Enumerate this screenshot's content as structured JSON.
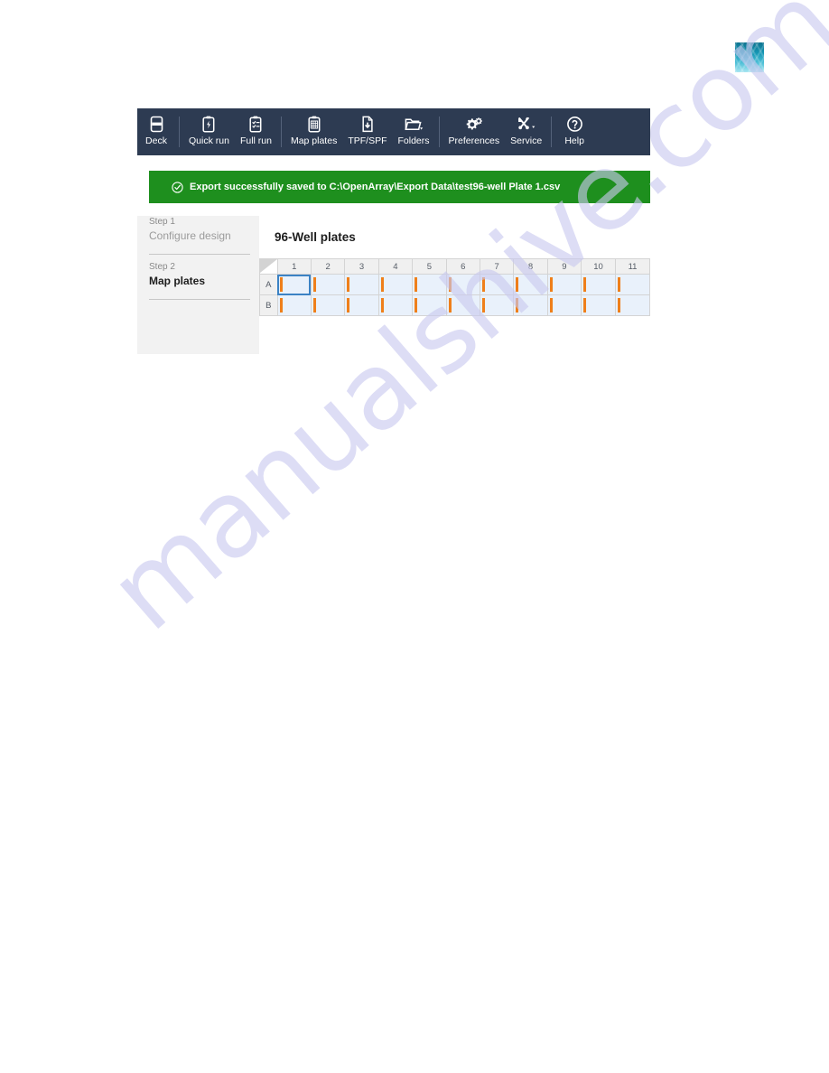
{
  "brand": {
    "logo_name": "applied-biosystems-logo",
    "accent_top": "#0e7490",
    "accent_bottom": "#a9e6f2"
  },
  "watermark": {
    "text": "manualshive.com",
    "color": "#c9c9ef"
  },
  "toolbar": {
    "background": "#2d3b52",
    "groups": [
      {
        "items": [
          {
            "label": "Deck",
            "icon": "deck-icon"
          }
        ]
      },
      {
        "items": [
          {
            "label": "Quick run",
            "icon": "clipboard-bolt-icon"
          },
          {
            "label": "Full run",
            "icon": "clipboard-list-icon"
          }
        ]
      },
      {
        "items": [
          {
            "label": "Map plates",
            "icon": "clipboard-grid-icon"
          },
          {
            "label": "TPF/SPF",
            "icon": "file-download-icon"
          },
          {
            "label": "Folders",
            "icon": "folder-dropdown-icon"
          }
        ]
      },
      {
        "items": [
          {
            "label": "Preferences",
            "icon": "gears-icon"
          },
          {
            "label": "Service",
            "icon": "tools-dropdown-icon"
          }
        ]
      },
      {
        "items": [
          {
            "label": "Help",
            "icon": "question-circle-icon"
          }
        ]
      }
    ]
  },
  "banner": {
    "icon": "check-circle-icon",
    "message": "Export successfully saved to C:\\OpenArray\\Export Data\\test96-well Plate 1.csv",
    "color": "#1e8f1e"
  },
  "sidebar": {
    "steps": [
      {
        "num": "Step 1",
        "name": "Configure design",
        "active": false
      },
      {
        "num": "Step 2",
        "name": "Map plates",
        "active": true
      }
    ]
  },
  "content": {
    "title": "96-Well plates",
    "grid": {
      "corner": "",
      "columns": [
        "1",
        "2",
        "3",
        "4",
        "5",
        "6",
        "7",
        "8",
        "9",
        "10",
        "11"
      ],
      "rows": [
        {
          "label": "A",
          "selected_column": "1"
        },
        {
          "label": "B",
          "selected_column": null
        }
      ],
      "well_fill": "#e9f1fb",
      "well_marker_color": "#ef7f1a",
      "selection_color": "#3b82c4"
    }
  }
}
